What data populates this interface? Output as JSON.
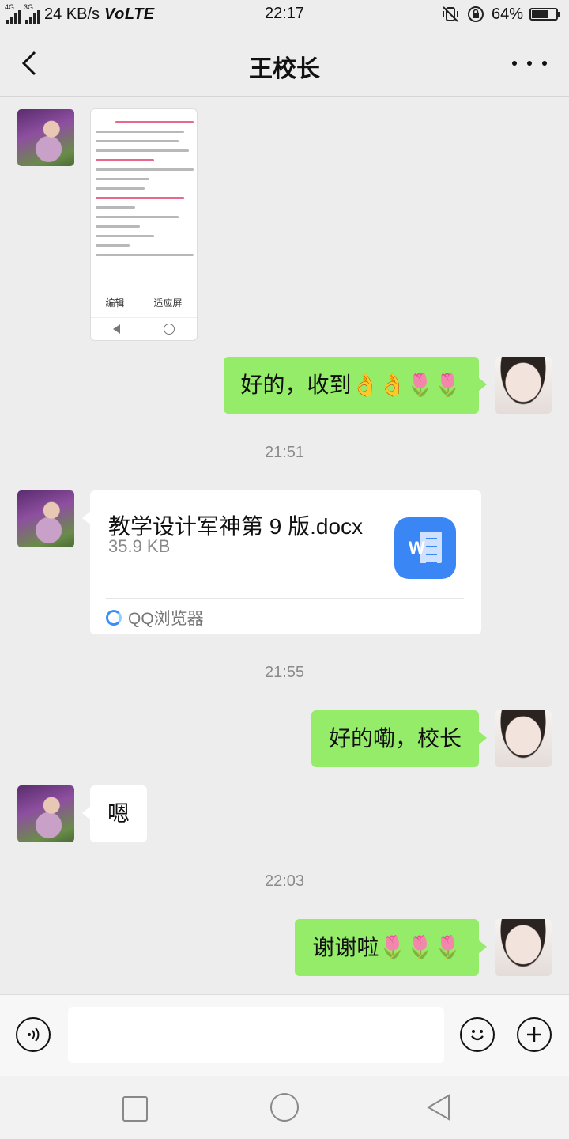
{
  "status_bar": {
    "net1": "4G",
    "net2": "3G",
    "speed": "24 KB/s",
    "volte": "VoLTE",
    "time": "22:17",
    "battery_text": "64%",
    "battery_level": 0.64
  },
  "header": {
    "title": "王校长",
    "back_icon": "chevron-left-icon",
    "more_icon": "more-dots-icon"
  },
  "image_message": {
    "toolbar_left": "编辑",
    "toolbar_right": "适应屏"
  },
  "messages": {
    "msg1": "好的，收到👌👌🌷🌷",
    "msg2": "好的嘞，校长",
    "msg3": "嗯",
    "msg4": "谢谢啦🌷🌷🌷"
  },
  "timestamps": {
    "t1": "21:51",
    "t2": "21:55",
    "t3": "22:03"
  },
  "file_card": {
    "name": "教学设计军神第 9 版.docx",
    "size": "35.9 KB",
    "icon_letter": "W",
    "source": "QQ浏览器"
  },
  "input_bar": {
    "placeholder": "",
    "voice_icon": "voice-icon",
    "emoji_icon": "emoji-icon",
    "plus_icon": "plus-icon"
  },
  "colors": {
    "mine_bubble": "#95ec69",
    "theirs_bubble": "#ffffff",
    "background": "#ededed"
  }
}
